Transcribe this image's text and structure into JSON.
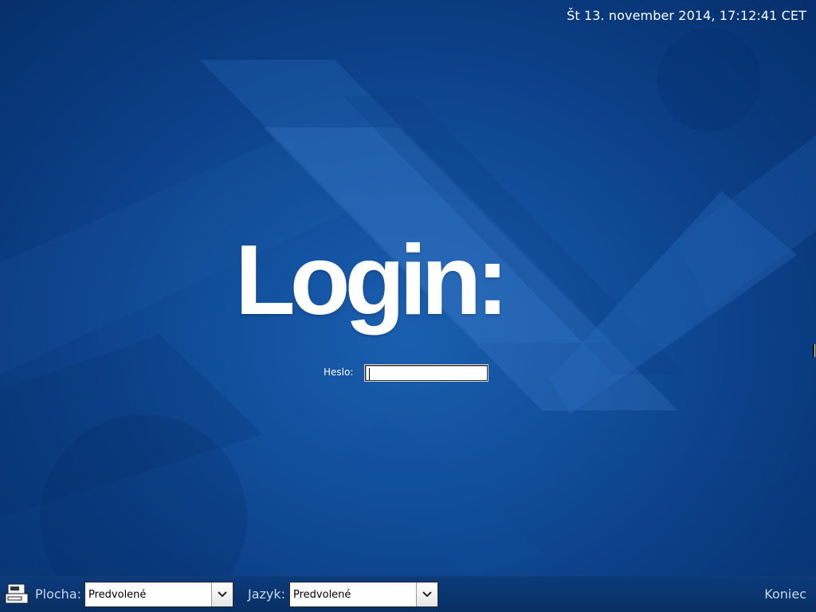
{
  "clock": {
    "text": "Št 13. november 2014, 17:12:41 CET"
  },
  "login": {
    "title": "Login:",
    "password_label": "Heslo:",
    "password_value": ""
  },
  "bottom_bar": {
    "terminal_icon": "terminal-icon",
    "session_label": "Plocha:",
    "session_value": "Predvolené",
    "language_label": "Jazyk:",
    "language_value": "Predvolené",
    "dropdown_icon": "chevron-down-icon",
    "quit_label": "Koniec"
  },
  "colors": {
    "background": "#0c3f86",
    "bar": "#0a3570",
    "text": "#ffffff",
    "bar_text": "#c8d6ea"
  }
}
